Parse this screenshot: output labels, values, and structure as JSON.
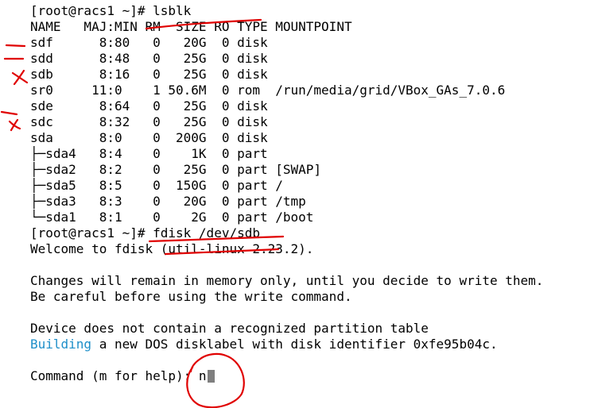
{
  "terminal": {
    "prompt_lsblk": "[root@racs1 ~]# lsblk",
    "header": "NAME   MAJ:MIN RM  SIZE RO TYPE MOUNTPOINT",
    "rows": [
      "sdf      8:80   0   20G  0 disk",
      "sdd      8:48   0   25G  0 disk",
      "sdb      8:16   0   25G  0 disk",
      "sr0     11:0    1 50.6M  0 rom  /run/media/grid/VBox_GAs_7.0.6",
      "sde      8:64   0   25G  0 disk",
      "sdc      8:32   0   25G  0 disk",
      "sda      8:0    0  200G  0 disk",
      "├─sda4   8:4    0    1K  0 part",
      "├─sda2   8:2    0   25G  0 part [SWAP]",
      "├─sda5   8:5    0  150G  0 part /",
      "├─sda3   8:3    0   20G  0 part /tmp",
      "└─sda1   8:1    0    2G  0 part /boot"
    ],
    "prompt_fdisk": "[root@racs1 ~]# fdisk /dev/sdb",
    "welcome": "Welcome to fdisk (util-linux 2.23.2).",
    "changes": "Changes will remain in memory only, until you decide to write them.",
    "careful": "Be careful before using the write command.",
    "device": "Device does not contain a recognized partition table",
    "building_word": "Building",
    "building_rest": " a new DOS disklabel with disk identifier 0xfe95b04c.",
    "command_prompt": "Command (m for help): ",
    "command_input": "n"
  },
  "colors": {
    "background": "#ffffff",
    "text": "#000000",
    "highlight": "#1e8fc9",
    "annotation": "#e00000",
    "cursor": "#7f7f7f"
  }
}
